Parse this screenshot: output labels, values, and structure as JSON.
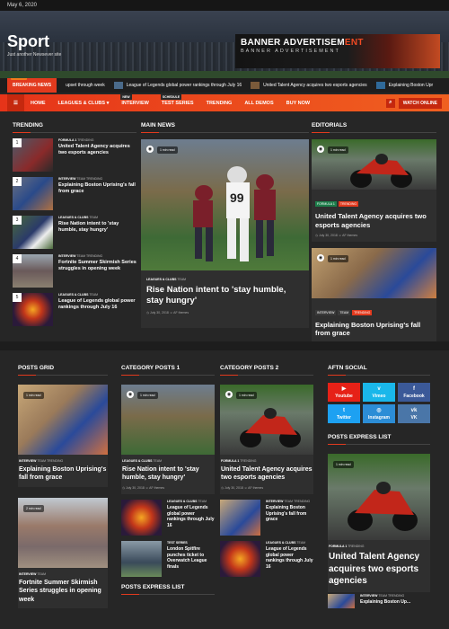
{
  "topbar": {
    "date": "May 6, 2020"
  },
  "site": {
    "title": "Sport",
    "tagline": "Just another Newsever site"
  },
  "banner": {
    "line1_a": "BANNER ADVERTISEM",
    "line1_b": "ENT",
    "line2": "BANNER ADVERTISEMENT"
  },
  "ticker": {
    "label": "BREAKING NEWS",
    "items": [
      "upset through week",
      "League of Legends global power rankings through July 16",
      "United Talent Agency acquires two esports agencies",
      "Explaining Boston Upr"
    ]
  },
  "nav": {
    "items": [
      {
        "label": "HOME",
        "sub": ""
      },
      {
        "label": "LEAGUES & CLUBS ▾",
        "sub": ""
      },
      {
        "label": "INTERVIEW",
        "sub": "NEW"
      },
      {
        "label": "TEST SERIES",
        "sub": "SCHEDULE"
      },
      {
        "label": "TRENDING",
        "sub": ""
      },
      {
        "label": "ALL DEMOS",
        "sub": ""
      },
      {
        "label": "BUY NOW",
        "sub": ""
      }
    ],
    "watch_label": "WATCH ONLINE"
  },
  "trending": {
    "title": "TRENDING",
    "items": [
      {
        "n": "1",
        "cats": [
          "FORMULA 1",
          "TRENDING"
        ],
        "title": "United Talent Agency acquires two esports agencies"
      },
      {
        "n": "2",
        "cats": [
          "INTERVIEW",
          "TEAM",
          "TRENDING"
        ],
        "title": "Explaining Boston Uprising's fall from grace"
      },
      {
        "n": "3",
        "cats": [
          "LEAGUES & CLUBS",
          "TEAM"
        ],
        "title": "Rise Nation intent to 'stay humble, stay hungry'"
      },
      {
        "n": "4",
        "cats": [
          "INTERVIEW",
          "TEAM",
          "TRENDING"
        ],
        "title": "Fortnite Summer Skirmish Series struggles in opening week"
      },
      {
        "n": "5",
        "cats": [
          "LEAGUES & CLUBS",
          "TEAM"
        ],
        "title": "League of Legends global power rankings through July 16"
      }
    ]
  },
  "main_news": {
    "title": "MAIN NEWS",
    "read": "1 min read",
    "cats": [
      "LEAGUES & CLUBS",
      "TEAM"
    ],
    "headline": "Rise Nation intent to 'stay humble, stay hungry'",
    "meta": "◷ July 30, 2018   ☺ AF themes"
  },
  "editorials": {
    "title": "EDITORIALS",
    "items": [
      {
        "read": "1 min read",
        "cats": [
          "FORMULA 1",
          "TRENDING"
        ],
        "title": "United Talent Agency acquires two esports agencies",
        "meta": "◷ July 30, 2018   ☺ AF themes"
      },
      {
        "read": "1 min read",
        "cats": [
          "INTERVIEW",
          "TEAM",
          "TRENDING"
        ],
        "title": "Explaining Boston Uprising's fall from grace",
        "meta": "◷ July 30, 2018   ☺ AF themes"
      }
    ]
  },
  "posts_grid": {
    "title": "POSTS GRID",
    "items": [
      {
        "read": "1 min read",
        "cats": [
          "INTERVIEW",
          "TEAM",
          "TRENDING"
        ],
        "title": "Explaining Boston Uprising's fall from grace"
      },
      {
        "read": "2 min read",
        "cats": [
          "INTERVIEW",
          "TEAM"
        ],
        "title": "Fortnite Summer Skirmish Series struggles in opening week"
      }
    ]
  },
  "cat_posts_1": {
    "title": "CATEGORY POSTS 1",
    "main": {
      "read": "1 min read",
      "cats": [
        "LEAGUES & CLUBS",
        "TEAM"
      ],
      "title": "Rise Nation intent to 'stay humble, stay hungry'",
      "meta": "◷ July 30, 2018   ☺ AF themes"
    },
    "list": [
      {
        "cats": [
          "LEAGUES & CLUBS",
          "TEAM"
        ],
        "title": "League of Legends global power rankings through July 16"
      },
      {
        "cats": [
          "TEST SERIES"
        ],
        "title": "London Spitfire punches ticket to Overwatch League finals"
      }
    ],
    "footer": "POSTS EXPRESS LIST"
  },
  "cat_posts_2": {
    "title": "CATEGORY POSTS 2",
    "main": {
      "read": "1 min read",
      "cats": [
        "FORMULA 1",
        "TRENDING"
      ],
      "title": "United Talent Agency acquires two esports agencies",
      "meta": "◷ July 30, 2018   ☺ AF themes"
    },
    "list": [
      {
        "cats": [
          "INTERVIEW",
          "TEAM",
          "TRENDING"
        ],
        "title": "Explaining Boston Uprising's fall from grace"
      },
      {
        "cats": [
          "LEAGUES & CLUBS",
          "TEAM"
        ],
        "title": "League of Legends global power rankings through July 16"
      }
    ]
  },
  "social": {
    "title": "AFTN SOCIAL",
    "buttons": [
      {
        "label": "Youtube",
        "glyph": "▶",
        "color": "#e62117"
      },
      {
        "label": "Vimeo",
        "glyph": "v",
        "color": "#1ab7ea"
      },
      {
        "label": "Facebook",
        "glyph": "f",
        "color": "#3b5998"
      },
      {
        "label": "Twitter",
        "glyph": "t",
        "color": "#1da1f2"
      },
      {
        "label": "Instagram",
        "glyph": "◎",
        "color": "#2c8dd6"
      },
      {
        "label": "VK",
        "glyph": "vk",
        "color": "#4a76a8"
      }
    ]
  },
  "express": {
    "title": "POSTS EXPRESS LIST",
    "main": {
      "read": "1 min read",
      "cats": [
        "FORMULA 1",
        "TRENDING"
      ],
      "title": "United Talent Agency acquires two esports agencies"
    },
    "next": {
      "cats": [
        "INTERVIEW",
        "TEAM",
        "TRENDING"
      ],
      "title": "Explaining Boston Up..."
    }
  }
}
